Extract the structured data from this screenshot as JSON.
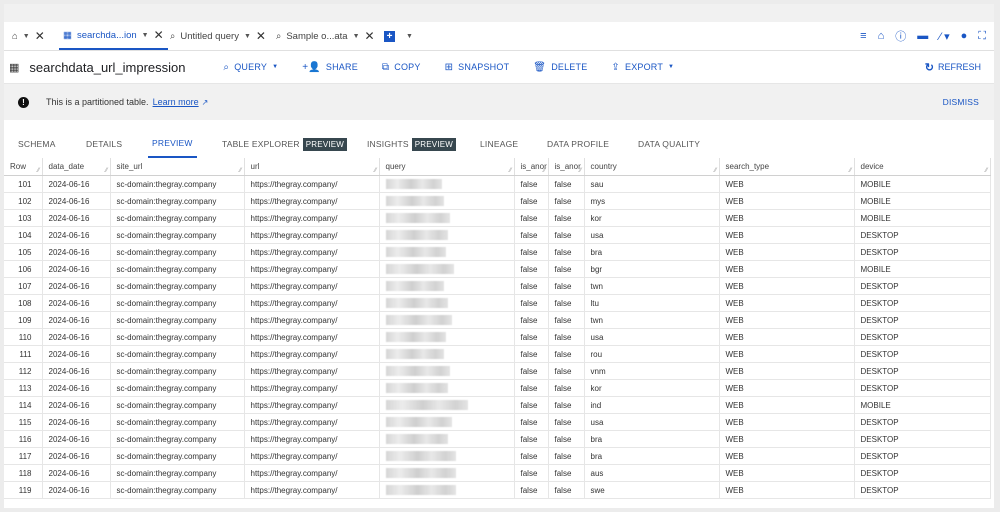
{
  "tabs": [
    {
      "label": "",
      "icon": "home-icon"
    },
    {
      "label": "searchda...ion",
      "icon": "table-icon",
      "active": true
    },
    {
      "label": "Untitled query",
      "icon": "query-icon"
    },
    {
      "label": "Sample o...ata",
      "icon": "query-icon"
    }
  ],
  "header_icons": [
    "list-icon",
    "home-icon",
    "info-icon",
    "keyboard-icon",
    "magic-wand-icon",
    "lightbulb-icon",
    "fullscreen-icon"
  ],
  "toolbar": {
    "title": "searchdata_url_impression",
    "query": "QUERY",
    "share": "SHARE",
    "copy": "COPY",
    "snapshot": "SNAPSHOT",
    "delete": "DELETE",
    "export": "EXPORT",
    "refresh": "REFRESH"
  },
  "banner": {
    "message": "This is a partitioned table.",
    "link": "Learn more",
    "dismiss": "DISMISS"
  },
  "subtabs": {
    "schema": "SCHEMA",
    "details": "DETAILS",
    "preview": "PREVIEW",
    "table_explorer": "TABLE EXPLORER",
    "insights": "INSIGHTS",
    "badge": "PREVIEW",
    "lineage": "LINEAGE",
    "data_profile": "DATA PROFILE",
    "data_quality": "DATA QUALITY"
  },
  "table": {
    "columns": [
      "Row",
      "data_date",
      "site_url",
      "url",
      "query",
      "is_anor",
      "is_anor",
      "country",
      "search_type",
      "device"
    ],
    "rows": [
      [
        "101",
        "2024-06-16",
        "sc-domain:thegray.company",
        "https://thegray.company/",
        "",
        "false",
        "false",
        "sau",
        "WEB",
        "MOBILE"
      ],
      [
        "102",
        "2024-06-16",
        "sc-domain:thegray.company",
        "https://thegray.company/",
        "",
        "false",
        "false",
        "mys",
        "WEB",
        "MOBILE"
      ],
      [
        "103",
        "2024-06-16",
        "sc-domain:thegray.company",
        "https://thegray.company/",
        "",
        "false",
        "false",
        "kor",
        "WEB",
        "MOBILE"
      ],
      [
        "104",
        "2024-06-16",
        "sc-domain:thegray.company",
        "https://thegray.company/",
        "",
        "false",
        "false",
        "usa",
        "WEB",
        "DESKTOP"
      ],
      [
        "105",
        "2024-06-16",
        "sc-domain:thegray.company",
        "https://thegray.company/",
        "",
        "false",
        "false",
        "bra",
        "WEB",
        "DESKTOP"
      ],
      [
        "106",
        "2024-06-16",
        "sc-domain:thegray.company",
        "https://thegray.company/",
        "",
        "false",
        "false",
        "bgr",
        "WEB",
        "MOBILE"
      ],
      [
        "107",
        "2024-06-16",
        "sc-domain:thegray.company",
        "https://thegray.company/",
        "",
        "false",
        "false",
        "twn",
        "WEB",
        "DESKTOP"
      ],
      [
        "108",
        "2024-06-16",
        "sc-domain:thegray.company",
        "https://thegray.company/",
        "",
        "false",
        "false",
        "ltu",
        "WEB",
        "DESKTOP"
      ],
      [
        "109",
        "2024-06-16",
        "sc-domain:thegray.company",
        "https://thegray.company/",
        "",
        "false",
        "false",
        "twn",
        "WEB",
        "DESKTOP"
      ],
      [
        "110",
        "2024-06-16",
        "sc-domain:thegray.company",
        "https://thegray.company/",
        "",
        "false",
        "false",
        "usa",
        "WEB",
        "DESKTOP"
      ],
      [
        "111",
        "2024-06-16",
        "sc-domain:thegray.company",
        "https://thegray.company/",
        "",
        "false",
        "false",
        "rou",
        "WEB",
        "DESKTOP"
      ],
      [
        "112",
        "2024-06-16",
        "sc-domain:thegray.company",
        "https://thegray.company/",
        "",
        "false",
        "false",
        "vnm",
        "WEB",
        "DESKTOP"
      ],
      [
        "113",
        "2024-06-16",
        "sc-domain:thegray.company",
        "https://thegray.company/",
        "",
        "false",
        "false",
        "kor",
        "WEB",
        "DESKTOP"
      ],
      [
        "114",
        "2024-06-16",
        "sc-domain:thegray.company",
        "https://thegray.company/",
        "",
        "false",
        "false",
        "ind",
        "WEB",
        "MOBILE"
      ],
      [
        "115",
        "2024-06-16",
        "sc-domain:thegray.company",
        "https://thegray.company/",
        "",
        "false",
        "false",
        "usa",
        "WEB",
        "DESKTOP"
      ],
      [
        "116",
        "2024-06-16",
        "sc-domain:thegray.company",
        "https://thegray.company/",
        "",
        "false",
        "false",
        "bra",
        "WEB",
        "DESKTOP"
      ],
      [
        "117",
        "2024-06-16",
        "sc-domain:thegray.company",
        "https://thegray.company/",
        "",
        "false",
        "false",
        "bra",
        "WEB",
        "DESKTOP"
      ],
      [
        "118",
        "2024-06-16",
        "sc-domain:thegray.company",
        "https://thegray.company/",
        "",
        "false",
        "false",
        "aus",
        "WEB",
        "DESKTOP"
      ],
      [
        "119",
        "2024-06-16",
        "sc-domain:thegray.company",
        "https://thegray.company/",
        "",
        "false",
        "false",
        "swe",
        "WEB",
        "DESKTOP"
      ]
    ]
  },
  "colors": {
    "accent": "#1a56c4",
    "badge_bg": "#37474f"
  }
}
